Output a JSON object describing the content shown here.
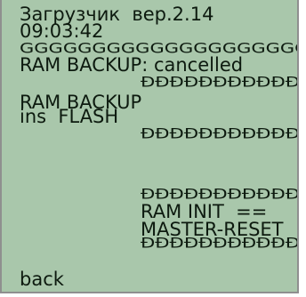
{
  "header": {
    "boot_label": "Загрузчик  вер.2.14",
    "time": "09:03:42"
  },
  "log_lines": {
    "g_line": "GGGGGGGGGGGGGGGGGGGGGG",
    "ram_backup_cancelled": "RAM BACKUP: cancelled",
    "d_line_1": "ĐĐĐĐĐĐĐĐĐĐĐĐ",
    "ram_backup": "RAM BACKUP",
    "ins_flash": "ins  FLASH",
    "d_line_2": "ĐĐĐĐĐĐĐĐĐĐĐĐ",
    "d_line_3": "ĐĐĐĐĐĐĐĐĐĐĐĐ",
    "ram_init": "RAM INIT  ==",
    "master_reset": "MASTER-RESET",
    "d_line_4": "ĐĐĐĐĐĐĐĐĐĐĐĐ"
  },
  "footer": {
    "back_label": "back"
  },
  "colors": {
    "screen_bg": "#a9c7ab",
    "text": "#0d1a0f",
    "border": "#8f8f8f"
  }
}
